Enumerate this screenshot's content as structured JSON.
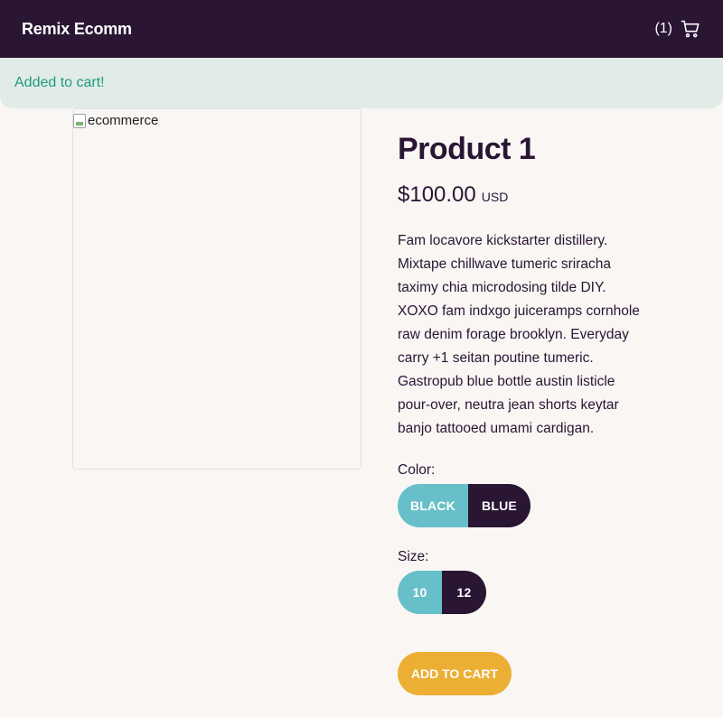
{
  "header": {
    "brand": "Remix Ecomm",
    "cart_count": "(1)",
    "cart_icon": "cart-icon"
  },
  "alert": {
    "message": "Added to cart!"
  },
  "product": {
    "image_alt": "ecommerce",
    "title": "Product 1",
    "price": "$100.00",
    "currency": "USD",
    "description": "Fam locavore kickstarter distillery. Mixtape chillwave tumeric sriracha taximy chia microdosing tilde DIY. XOXO fam indxgo juiceramps cornhole raw denim forage brooklyn. Everyday carry +1 seitan poutine tumeric. Gastropub blue bottle austin listicle pour-over, neutra jean shorts keytar banjo tattooed umami cardigan.",
    "color": {
      "label": "Color:",
      "options": [
        "BLACK",
        "BLUE"
      ],
      "selected": "BLUE"
    },
    "size": {
      "label": "Size:",
      "options": [
        "10",
        "12"
      ],
      "selected": "12"
    },
    "add_to_cart_label": "ADD TO CART"
  },
  "colors": {
    "header_bg": "#2a1533",
    "alert_bg": "#e1ebe7",
    "alert_text": "#1f9a7d",
    "option_unselected": "#67c0c9",
    "option_selected": "#2a1533",
    "add_to_cart": "#ecaf33"
  }
}
